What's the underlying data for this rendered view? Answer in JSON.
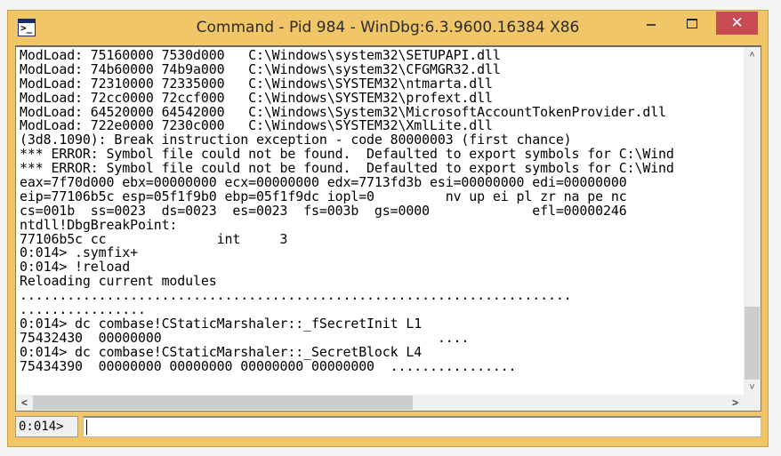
{
  "window": {
    "title": "Command - Pid 984 - WinDbg:6.3.9600.16384 X86",
    "icon": "console-prompt-icon",
    "icon_glyph": ">_",
    "controls": {
      "minimize": "minimize-icon",
      "maximize": "maximize-icon",
      "close": "close-icon",
      "close_glyph": "✕"
    },
    "accent_color": "#f0c668",
    "close_color": "#c74b50"
  },
  "output": {
    "lines": [
      "ModLoad: 75160000 7530d000   C:\\Windows\\system32\\SETUPAPI.dll",
      "ModLoad: 74b60000 74b9a000   C:\\Windows\\system32\\CFGMGR32.dll",
      "ModLoad: 72310000 72335000   C:\\Windows\\SYSTEM32\\ntmarta.dll",
      "ModLoad: 72cc0000 72ccf000   C:\\Windows\\SYSTEM32\\profext.dll",
      "ModLoad: 64520000 64542000   C:\\Windows\\System32\\MicrosoftAccountTokenProvider.dll",
      "ModLoad: 722e0000 7230c000   C:\\Windows\\SYSTEM32\\XmlLite.dll",
      "(3d8.1090): Break instruction exception - code 80000003 (first chance)",
      "*** ERROR: Symbol file could not be found.  Defaulted to export symbols for C:\\Wind",
      "*** ERROR: Symbol file could not be found.  Defaulted to export symbols for C:\\Wind",
      "eax=7f70d000 ebx=00000000 ecx=00000000 edx=7713fd3b esi=00000000 edi=00000000",
      "eip=77106b5c esp=05f1f9b0 ebp=05f1f9dc iopl=0         nv up ei pl zr na pe nc",
      "cs=001b  ss=0023  ds=0023  es=0023  fs=003b  gs=0000             efl=00000246",
      "ntdll!DbgBreakPoint:",
      "77106b5c cc              int     3",
      "0:014> .symfix+",
      "0:014> !reload",
      "Reloading current modules",
      "......................................................................",
      "................",
      "0:014> dc combase!CStaticMarshaler::_fSecretInit L1",
      "75432430  00000000                                   ....",
      "0:014> dc combase!CStaticMarshaler::_SecretBlock L4",
      "75434390  00000000 00000000 00000000 00000000  ................"
    ]
  },
  "scrollbars": {
    "vertical": {
      "up_glyph": "˄",
      "down_glyph": "˅",
      "position_fraction": 0.92
    },
    "horizontal": {
      "left_glyph": "<",
      "right_glyph": ">",
      "position_fraction": 0.0
    }
  },
  "command": {
    "prompt": "0:014>",
    "value": "",
    "placeholder": ""
  }
}
